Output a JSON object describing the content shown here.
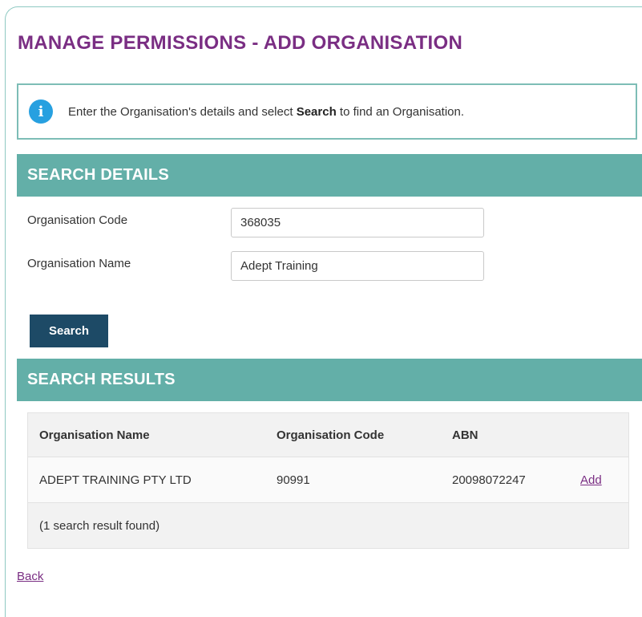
{
  "page": {
    "title": "MANAGE PERMISSIONS - ADD ORGANISATION"
  },
  "info": {
    "icon": "info-icon",
    "text_before": "Enter the Organisation's details and select ",
    "text_bold": "Search",
    "text_after": " to find an Organisation."
  },
  "search_details": {
    "heading": "SEARCH DETAILS",
    "org_code_label": "Organisation Code",
    "org_code_value": "368035",
    "org_name_label": "Organisation Name",
    "org_name_value": "Adept Training",
    "search_button": "Search"
  },
  "search_results": {
    "heading": "SEARCH RESULTS",
    "columns": [
      "Organisation Name",
      "Organisation Code",
      "ABN"
    ],
    "rows": [
      {
        "name": "ADEPT TRAINING PTY LTD",
        "code": "90991",
        "abn": "20098072247",
        "action": "Add"
      }
    ],
    "summary": "(1 search result found)"
  },
  "footer": {
    "back_link": "Back"
  },
  "colors": {
    "title": "#7a2e83",
    "section_bar": "#63afa8",
    "button": "#1d4a66",
    "info_icon": "#27a0e0",
    "link": "#7a2e83"
  }
}
